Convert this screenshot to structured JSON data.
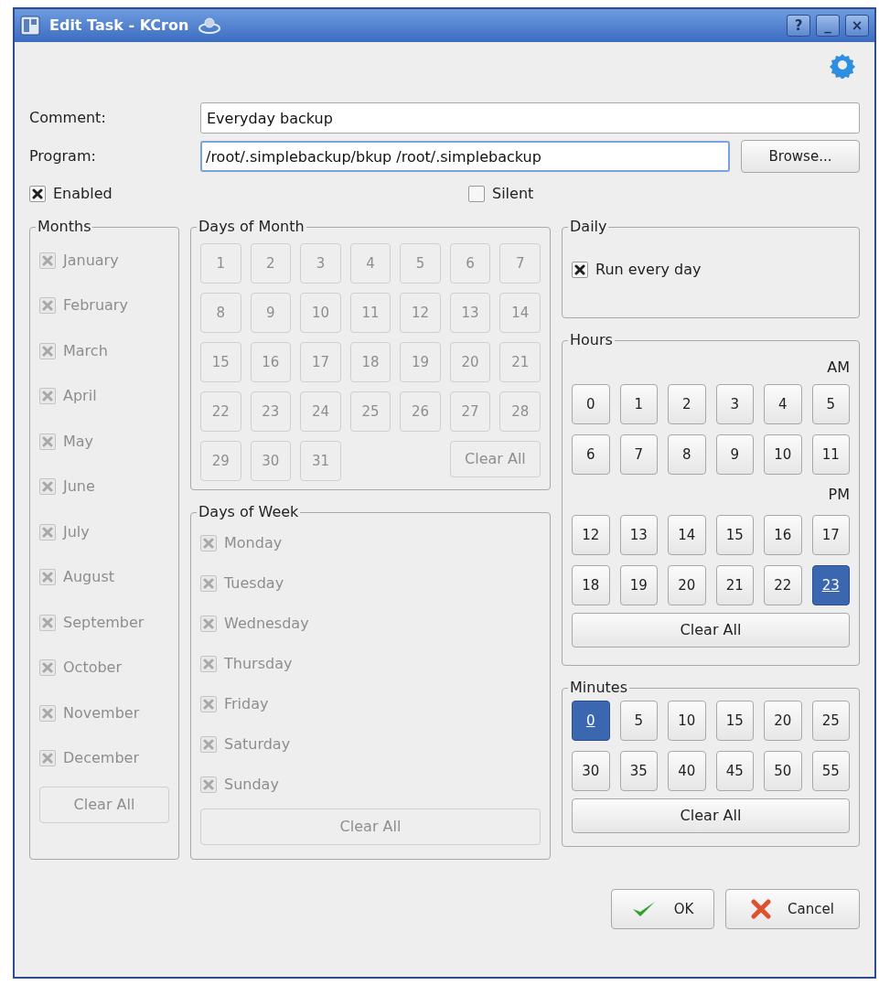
{
  "window": {
    "title": "Edit Task - KCron",
    "buttons": [
      "?",
      "_",
      "×"
    ]
  },
  "comment": {
    "label": "Comment:",
    "value": "Everyday backup"
  },
  "program": {
    "label": "Program:",
    "value": "/root/.simplebackup/bkup /root/.simplebackup",
    "browse": "Browse..."
  },
  "enabled": {
    "label": "Enabled",
    "checked": true
  },
  "silent": {
    "label": "Silent",
    "checked": false
  },
  "months": {
    "title": "Months",
    "disabled": true,
    "clear": "Clear All",
    "items": [
      {
        "label": "January",
        "checked": true
      },
      {
        "label": "February",
        "checked": true
      },
      {
        "label": "March",
        "checked": true
      },
      {
        "label": "April",
        "checked": true
      },
      {
        "label": "May",
        "checked": true
      },
      {
        "label": "June",
        "checked": true
      },
      {
        "label": "July",
        "checked": true
      },
      {
        "label": "August",
        "checked": true
      },
      {
        "label": "September",
        "checked": true
      },
      {
        "label": "October",
        "checked": true
      },
      {
        "label": "November",
        "checked": true
      },
      {
        "label": "December",
        "checked": true
      }
    ]
  },
  "days_of_month": {
    "title": "Days of Month",
    "disabled": true,
    "clear": "Clear All",
    "items": [
      {
        "label": "1",
        "selected": false
      },
      {
        "label": "2",
        "selected": false
      },
      {
        "label": "3",
        "selected": false
      },
      {
        "label": "4",
        "selected": false
      },
      {
        "label": "5",
        "selected": false
      },
      {
        "label": "6",
        "selected": false
      },
      {
        "label": "7",
        "selected": false
      },
      {
        "label": "8",
        "selected": false
      },
      {
        "label": "9",
        "selected": false
      },
      {
        "label": "10",
        "selected": false
      },
      {
        "label": "11",
        "selected": false
      },
      {
        "label": "12",
        "selected": false
      },
      {
        "label": "13",
        "selected": false
      },
      {
        "label": "14",
        "selected": false
      },
      {
        "label": "15",
        "selected": false
      },
      {
        "label": "16",
        "selected": false
      },
      {
        "label": "17",
        "selected": false
      },
      {
        "label": "18",
        "selected": false
      },
      {
        "label": "19",
        "selected": false
      },
      {
        "label": "20",
        "selected": false
      },
      {
        "label": "21",
        "selected": false
      },
      {
        "label": "22",
        "selected": false
      },
      {
        "label": "23",
        "selected": false
      },
      {
        "label": "24",
        "selected": false
      },
      {
        "label": "25",
        "selected": false
      },
      {
        "label": "26",
        "selected": false
      },
      {
        "label": "27",
        "selected": false
      },
      {
        "label": "28",
        "selected": false
      },
      {
        "label": "29",
        "selected": false
      },
      {
        "label": "30",
        "selected": false
      },
      {
        "label": "31",
        "selected": false
      }
    ]
  },
  "days_of_week": {
    "title": "Days of Week",
    "disabled": true,
    "clear": "Clear All",
    "items": [
      {
        "label": "Monday",
        "checked": true
      },
      {
        "label": "Tuesday",
        "checked": true
      },
      {
        "label": "Wednesday",
        "checked": true
      },
      {
        "label": "Thursday",
        "checked": true
      },
      {
        "label": "Friday",
        "checked": true
      },
      {
        "label": "Saturday",
        "checked": true
      },
      {
        "label": "Sunday",
        "checked": true
      }
    ]
  },
  "daily": {
    "title": "Daily",
    "label": "Run every day",
    "checked": true
  },
  "hours": {
    "title": "Hours",
    "am": "AM",
    "pm": "PM",
    "clear": "Clear All",
    "am_items": [
      {
        "label": "0",
        "selected": false
      },
      {
        "label": "1",
        "selected": false
      },
      {
        "label": "2",
        "selected": false
      },
      {
        "label": "3",
        "selected": false
      },
      {
        "label": "4",
        "selected": false
      },
      {
        "label": "5",
        "selected": false
      },
      {
        "label": "6",
        "selected": false
      },
      {
        "label": "7",
        "selected": false
      },
      {
        "label": "8",
        "selected": false
      },
      {
        "label": "9",
        "selected": false
      },
      {
        "label": "10",
        "selected": false
      },
      {
        "label": "11",
        "selected": false
      }
    ],
    "pm_items": [
      {
        "label": "12",
        "selected": false
      },
      {
        "label": "13",
        "selected": false
      },
      {
        "label": "14",
        "selected": false
      },
      {
        "label": "15",
        "selected": false
      },
      {
        "label": "16",
        "selected": false
      },
      {
        "label": "17",
        "selected": false
      },
      {
        "label": "18",
        "selected": false
      },
      {
        "label": "19",
        "selected": false
      },
      {
        "label": "20",
        "selected": false
      },
      {
        "label": "21",
        "selected": false
      },
      {
        "label": "22",
        "selected": false
      },
      {
        "label": "23",
        "selected": true
      }
    ]
  },
  "minutes": {
    "title": "Minutes",
    "clear": "Clear All",
    "items": [
      {
        "label": "0",
        "selected": true
      },
      {
        "label": "5",
        "selected": false
      },
      {
        "label": "10",
        "selected": false
      },
      {
        "label": "15",
        "selected": false
      },
      {
        "label": "20",
        "selected": false
      },
      {
        "label": "25",
        "selected": false
      },
      {
        "label": "30",
        "selected": false
      },
      {
        "label": "35",
        "selected": false
      },
      {
        "label": "40",
        "selected": false
      },
      {
        "label": "45",
        "selected": false
      },
      {
        "label": "50",
        "selected": false
      },
      {
        "label": "55",
        "selected": false
      }
    ]
  },
  "footer": {
    "ok": "OK",
    "cancel": "Cancel"
  }
}
